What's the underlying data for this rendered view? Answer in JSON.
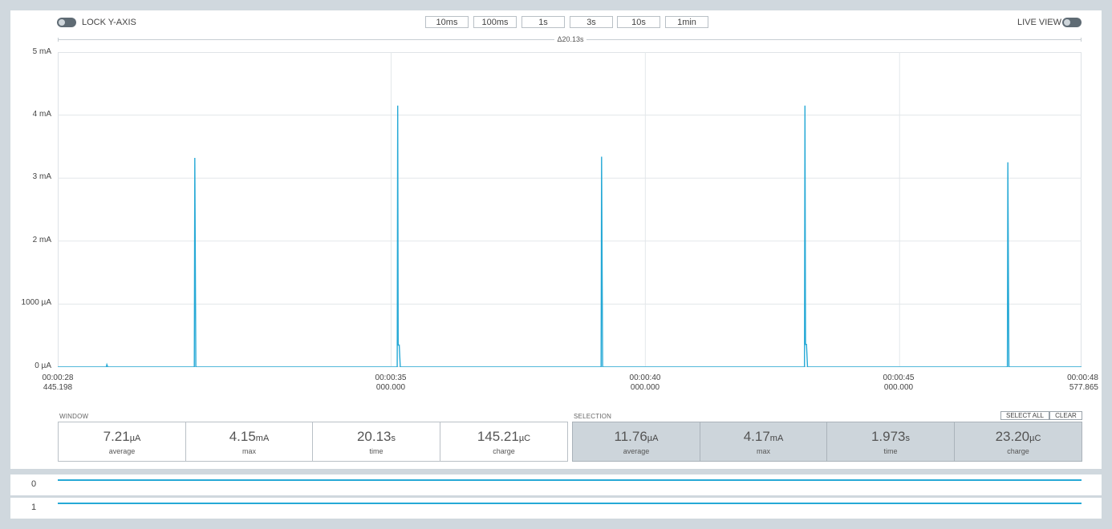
{
  "header": {
    "lock_y_axis_label": "LOCK Y-AXIS",
    "live_view_label": "LIVE VIEW",
    "time_buttons": [
      "10ms",
      "100ms",
      "1s",
      "3s",
      "10s",
      "1min"
    ],
    "delta_label": "Δ20.13s"
  },
  "colors": {
    "accent": "#26a9d6",
    "selection_bg": "#cdd5db",
    "outer_bg": "#d0d8de"
  },
  "chart_data": {
    "type": "line",
    "ylabel_ticks": [
      "5 mA",
      "4 mA",
      "3 mA",
      "2 mA",
      "1000 µA",
      "0 µA"
    ],
    "y_ticks_uA": [
      5000,
      4000,
      3000,
      2000,
      1000,
      0
    ],
    "ylim_uA": [
      0,
      5000
    ],
    "xlim_s": [
      28.445,
      48.578
    ],
    "x_ticks": [
      {
        "l1": "00:00:28",
        "l2": "445.198"
      },
      {
        "l1": "00:00:35",
        "l2": "000.000"
      },
      {
        "l1": "00:00:40",
        "l2": "000.000"
      },
      {
        "l1": "00:00:45",
        "l2": "000.000"
      },
      {
        "l1": "00:00:48",
        "l2": "577.865"
      }
    ],
    "x_tick_values_s": [
      28.445,
      35.0,
      40.0,
      45.0,
      48.578
    ],
    "grid": true,
    "series": [
      {
        "color": "#26a9d6",
        "points_s_uA": [
          [
            28.445,
            0
          ],
          [
            29.4,
            0
          ],
          [
            29.41,
            40
          ],
          [
            29.43,
            0
          ],
          [
            31.13,
            0
          ],
          [
            31.14,
            3320
          ],
          [
            31.16,
            0
          ],
          [
            35.12,
            0
          ],
          [
            35.13,
            4150
          ],
          [
            35.14,
            350
          ],
          [
            35.16,
            350
          ],
          [
            35.18,
            0
          ],
          [
            39.13,
            0
          ],
          [
            39.14,
            3340
          ],
          [
            39.16,
            0
          ],
          [
            43.13,
            0
          ],
          [
            43.14,
            4150
          ],
          [
            43.15,
            360
          ],
          [
            43.17,
            360
          ],
          [
            43.19,
            0
          ],
          [
            47.12,
            0
          ],
          [
            47.13,
            3250
          ],
          [
            47.15,
            0
          ],
          [
            48.578,
            0
          ]
        ]
      }
    ]
  },
  "window_stats": {
    "title": "WINDOW",
    "items": [
      {
        "value": "7.21",
        "unit": "µA",
        "label": "average"
      },
      {
        "value": "4.15",
        "unit": "mA",
        "label": "max"
      },
      {
        "value": "20.13",
        "unit": "s",
        "label": "time"
      },
      {
        "value": "145.21",
        "unit": "µC",
        "label": "charge"
      }
    ]
  },
  "selection_stats": {
    "title": "SELECTION",
    "select_all_label": "SELECT ALL",
    "clear_label": "CLEAR",
    "items": [
      {
        "value": "11.76",
        "unit": "µA",
        "label": "average"
      },
      {
        "value": "4.17",
        "unit": "mA",
        "label": "max"
      },
      {
        "value": "1.973",
        "unit": "s",
        "label": "time"
      },
      {
        "value": "23.20",
        "unit": "µC",
        "label": "charge"
      }
    ]
  },
  "digital_channels": [
    {
      "label": "0"
    },
    {
      "label": "1"
    }
  ]
}
